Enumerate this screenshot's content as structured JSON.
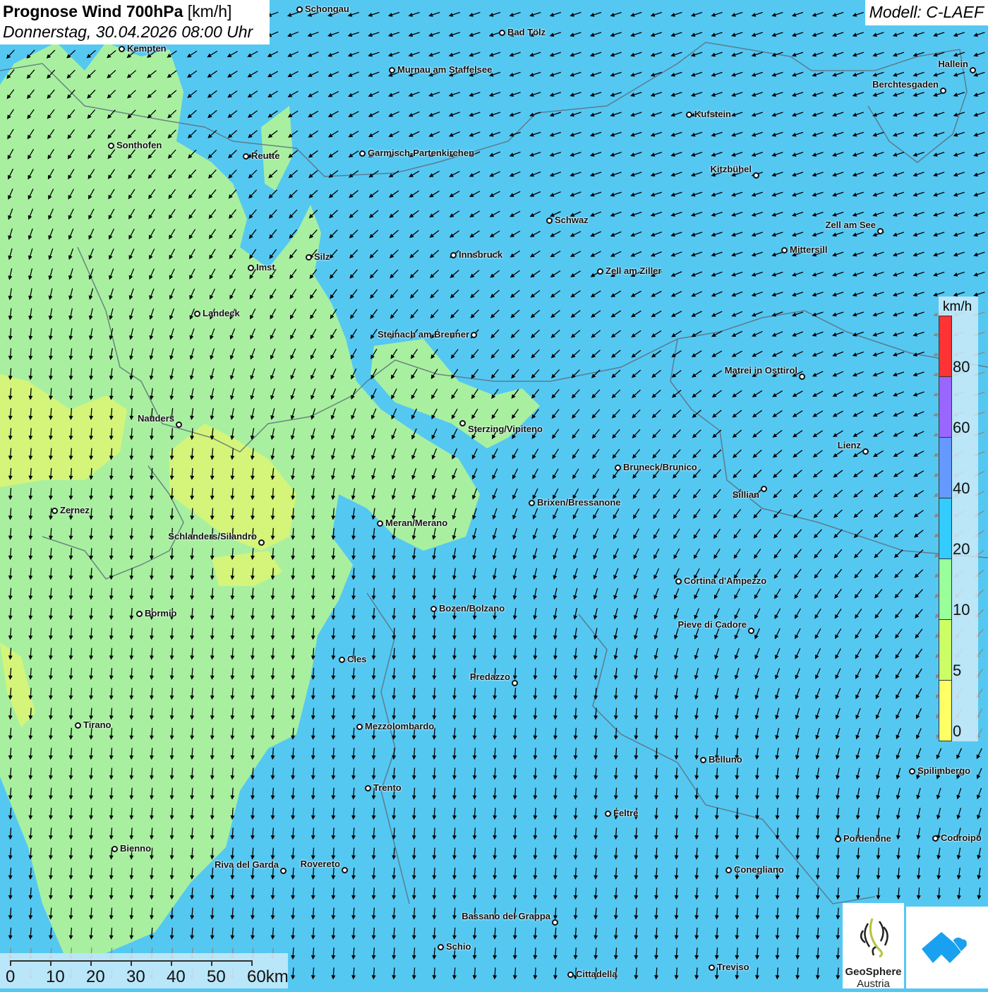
{
  "header": {
    "title_bold": "Prognose Wind 700hPa",
    "title_unit": "[km/h]",
    "datetime": "Donnerstag, 30.04.2026 08:00 Uhr",
    "model": "Modell: C-LAEF"
  },
  "legend": {
    "unit": "km/h",
    "ticks": [
      "80",
      "60",
      "40",
      "20",
      "10",
      "5",
      "0"
    ],
    "colors": [
      "#ff3333",
      "#9966ff",
      "#6699ff",
      "#33ccff",
      "#99ff99",
      "#ccff66",
      "#ffff66"
    ]
  },
  "scale_bar": {
    "labels": [
      "0",
      "10",
      "20",
      "30",
      "40",
      "50",
      "60km"
    ]
  },
  "logos": {
    "geosphere_line1": "GeoSphere",
    "geosphere_line2": "Austria"
  },
  "cities": [
    "Schongau",
    "Bad Tölz",
    "Kempten",
    "Murnau am Staffelsee",
    "Hallein",
    "Berchtesgaden",
    "Kufstein",
    "Sonthofen",
    "Reutte",
    "Garmisch-Partenkirchen",
    "Kitzbühel",
    "Schwaz",
    "Zell am See",
    "Mittersill",
    "Innsbruck",
    "Silz",
    "Imst",
    "Zell am Ziller",
    "Landeck",
    "Steinach am Brenner",
    "Matrei in Osttirol",
    "Nauders",
    "Sterzing/Vipiteno",
    "Lienz",
    "Bruneck/Brunico",
    "Sillian",
    "Brixen/Bressanone",
    "Zernez",
    "Meran/Merano",
    "Schlanders/Silandro",
    "Cortina d'Ampezzo",
    "Bozen/Bolzano",
    "Bormio",
    "Pieve di Cadore",
    "Cles",
    "Predazzo",
    "Tirano",
    "Mezzolombardo",
    "Belluno",
    "Spilimbergo",
    "Trento",
    "Feltre",
    "Pordenone",
    "Codroipo",
    "Bienno",
    "Riva del Garda",
    "Rovereto",
    "Conegliano",
    "Bassano del Grappa",
    "Schio",
    "Treviso",
    "Cittadella"
  ],
  "colors": {
    "water_blue": "#55c8f2",
    "wind_green": "#a8f0a0",
    "wind_yellowgreen": "#d4f57a"
  }
}
